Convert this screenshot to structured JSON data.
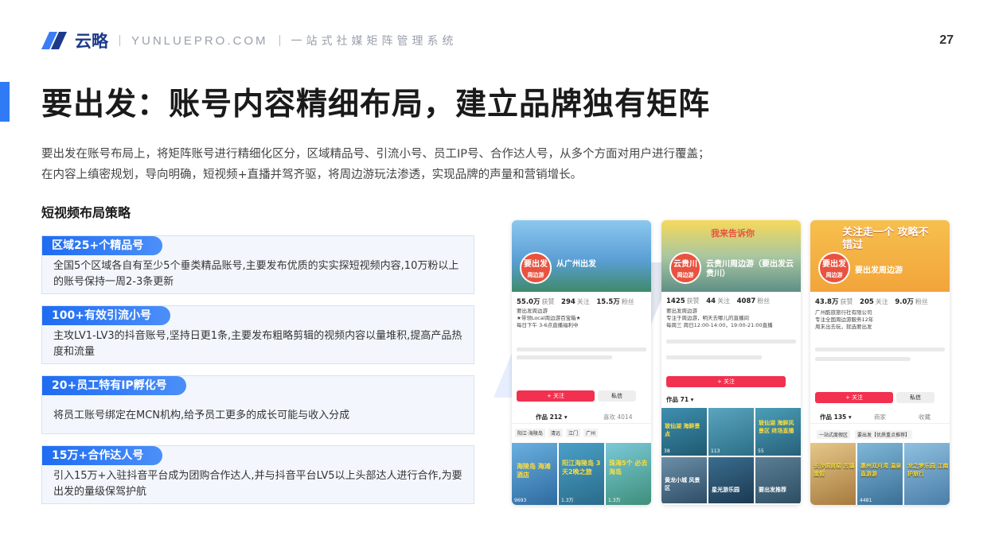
{
  "header": {
    "brand": "云略",
    "site": "YUNLUEPRO.COM",
    "slogan": "一站式社媒矩阵管理系统",
    "page_number": "27"
  },
  "title": "要出发：账号内容精细布局，建立品牌独有矩阵",
  "intro": {
    "line1": "要出发在账号布局上，将矩阵账号进行精细化区分，区域精品号、引流小号、员工IP号、合作达人号，从多个方面对用户进行覆盖；",
    "line2": "在内容上缜密规划，导向明确，短视频+直播并驾齐驱，将周边游玩法渗透，实现品牌的声量和营销增长。"
  },
  "section_heading": "短视频布局策略",
  "strategies": [
    {
      "tag": "区域25+个精品号",
      "body": "全国5个区域各自有至少5个垂类精品账号,主要发布优质的实实探短视频内容,10万粉以上的账号保持一周2-3条更新"
    },
    {
      "tag": "100+有效引流小号",
      "body": "主攻LV1-LV3的抖音账号,坚持日更1条,主要发布粗略剪辑的视频内容以量堆积,提高产品热度和流量"
    },
    {
      "tag": "20+员工特有IP孵化号",
      "body": "将员工账号绑定在MCN机构,给予员工更多的成长可能与收入分成"
    },
    {
      "tag": "15万+合作达人号",
      "body": "引入15万+入驻抖音平台成为团购合作达人,并与抖音平台LV5以上头部达人进行合作,为要出发的量级保驾护航"
    }
  ],
  "phones": [
    {
      "avatar": "要出发",
      "avatar_sub": "周边游",
      "name": "从广州出发",
      "stats": [
        {
          "v": "55.0万",
          "l": "获赞"
        },
        {
          "v": "294",
          "l": "关注"
        },
        {
          "v": "15.5万",
          "l": "粉丝"
        }
      ],
      "bio1": "要出发周边游",
      "bio2": "★带领Local周边游百宝箱★",
      "bio3": "每日下午 3-6点直播福利中",
      "follow": "+ 关注",
      "msg": "私信",
      "tab1": "作品 212 ▾",
      "tab2": "喜欢 4014",
      "chips": [
        "阳江·海陵岛",
        "清远",
        "江门",
        "广州"
      ],
      "thumbs": [
        "海陵岛 海滩酒店",
        "阳江海陵岛 3天2晚之旅",
        "珠海5个 必去海岛"
      ],
      "likes": [
        "9693",
        "1.3万",
        "1.3万"
      ],
      "banner": "#5b9fd6",
      "avatar_color": "#e8523f"
    },
    {
      "avatar": "云贵川",
      "avatar_sub": "周边游",
      "name": "云贵川周边游（要出发云贵川）",
      "stats": [
        {
          "v": "1425",
          "l": "获赞"
        },
        {
          "v": "44",
          "l": "关注"
        },
        {
          "v": "4087",
          "l": "粉丝"
        }
      ],
      "bio1": "要出发周边游",
      "bio2": "专注于周边游，明天去哪儿的直播间",
      "bio3": "每周三 周日12:00-14:00，19:00-21:00直播",
      "follow": "+ 关注",
      "msg": "",
      "tab1": "作品 71 ▾",
      "tab2": "",
      "chips": [],
      "thumbs": [
        "玻仙湖 海鲜景点",
        "玻仙湖 海鲜风景区 终场直播",
        "",
        "黄龙小城 风景区",
        "星光游乐园",
        "要出发推荐"
      ],
      "likes": [
        "38",
        "113",
        "55"
      ],
      "banner": "#7ca7a0",
      "avatar_color": "#e8523f"
    },
    {
      "avatar": "要出发",
      "avatar_sub": "周边游",
      "name": "要出发周边游",
      "stats": [
        {
          "v": "43.8万",
          "l": "获赞"
        },
        {
          "v": "205",
          "l": "关注"
        },
        {
          "v": "9.0万",
          "l": "粉丝"
        }
      ],
      "bio1": "广州酷旅旅行社有限公司",
      "bio2": "专注全国周边游服务12年",
      "bio3": "周末出去玩，就选要出发",
      "follow": "+ 关注",
      "msg": "私信",
      "tab1": "作品 135 ▾",
      "tab2": "商家",
      "tab3": "收藏",
      "chips": [
        "一站式度假区",
        "要出发【优质重点推荐】"
      ],
      "thumbs": [
        "长沙铜官窑 古镇度假",
        "惠州双月湾 温泉直游游",
        "龙之梦乐园 江南护旅行"
      ],
      "likes": [
        "",
        "4481",
        ""
      ],
      "banner": "#f6c04d",
      "avatar_color": "#e8523f"
    }
  ],
  "banner_texts": [
    "",
    "我来告诉你",
    "关注走一个 攻略不错过"
  ],
  "colors": {
    "accent": "#2f7bf5",
    "follow_red": "#f2304f",
    "brand_navy": "#1d3a8a"
  }
}
